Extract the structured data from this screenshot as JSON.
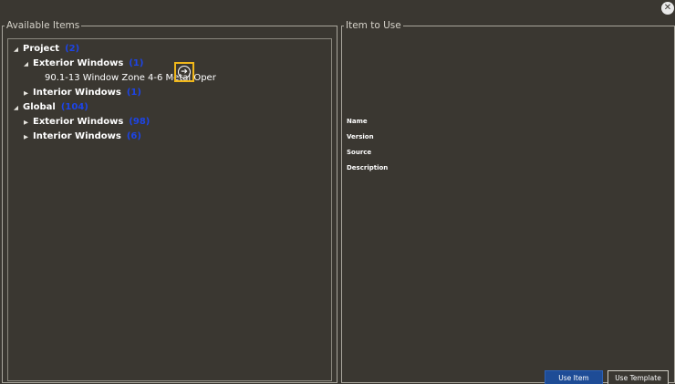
{
  "window": {
    "close_symbol": "✕"
  },
  "available": {
    "legend": "Available Items",
    "tree": [
      {
        "label": "Project",
        "count": "(2)",
        "expanded": true
      },
      {
        "label": "Exterior Windows",
        "count": "(1)",
        "expanded": true
      },
      {
        "label": "90.1-13 Window Zone 4-6 Metal Oper"
      },
      {
        "label": "Interior Windows",
        "count": "(1)",
        "expanded": false
      },
      {
        "label": "Global",
        "count": "(104)",
        "expanded": true
      },
      {
        "label": "Exterior Windows",
        "count": "(98)",
        "expanded": false
      },
      {
        "label": "Interior Windows",
        "count": "(6)",
        "expanded": false
      }
    ],
    "expand_symbols": {
      "open": "◢",
      "closed": "▶"
    },
    "add_icon_symbol": "➔"
  },
  "use": {
    "legend": "Item to Use",
    "fields": {
      "name": "Name",
      "version": "Version",
      "source": "Source",
      "description": "Description"
    },
    "buttons": {
      "use_item": "Use Item",
      "use_template": "Use Template"
    }
  },
  "colors": {
    "background": "#3a3731",
    "count_text": "#1d44e6",
    "highlight": "#f0b71a",
    "primary_button": "#1e4c96"
  }
}
